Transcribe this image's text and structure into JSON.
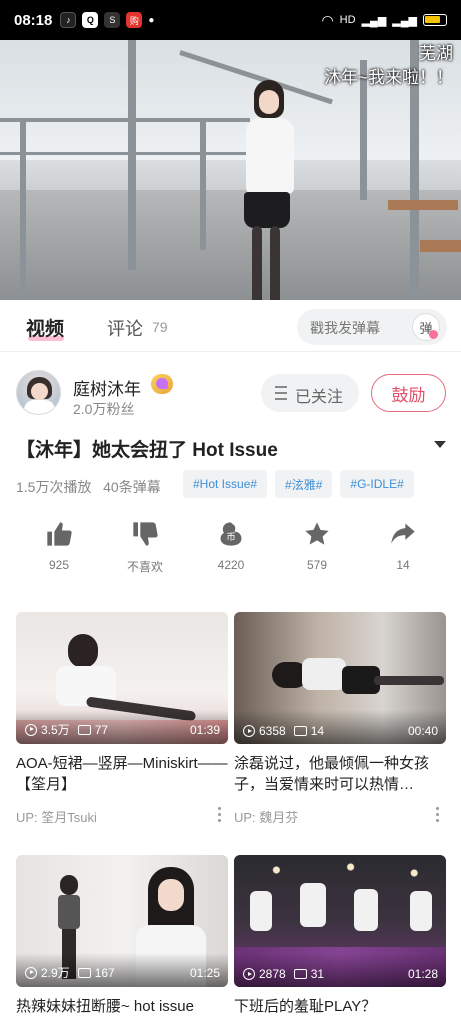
{
  "status_bar": {
    "time": "08:18",
    "network_label": "HD"
  },
  "video": {
    "overlay_line1": "芜湖",
    "overlay_line2": "沐年~我来啦！！"
  },
  "tabs": {
    "video_label": "视频",
    "comments_label": "评论",
    "comments_count": "79",
    "danmaku_placeholder": "戳我发弹幕",
    "danmaku_toggle_label": "弹"
  },
  "uploader": {
    "name": "庭树沐年",
    "fans": "2.0万粉丝",
    "follow_label": "已关注",
    "encourage_label": "鼓励"
  },
  "video_info": {
    "title": "【沐年】她太会扭了 Hot Issue",
    "plays": "1.5万次播放",
    "danmaku_count": "40条弹幕",
    "tags": [
      "#Hot Issue#",
      "#泫雅#",
      "#G-IDLE#"
    ]
  },
  "actions": [
    {
      "icon": "thumbs-up-icon",
      "label": "925"
    },
    {
      "icon": "thumbs-down-icon",
      "label": "不喜欢"
    },
    {
      "icon": "coin-icon",
      "label": "4220"
    },
    {
      "icon": "star-icon",
      "label": "579"
    },
    {
      "icon": "share-icon",
      "label": "14"
    }
  ],
  "recommendations": [
    {
      "plays": "3.5万",
      "danmaku": "77",
      "duration": "01:39",
      "title": "AOA-短裙—竖屏—Miniskirt——【筌月】",
      "up": "UP: 筌月Tsuki"
    },
    {
      "plays": "6358",
      "danmaku": "14",
      "duration": "00:40",
      "title": "涂磊说过，他最倾佩一种女孩子，当爱情来时可以热情…",
      "up": "UP: 魏月芬"
    },
    {
      "plays": "2.9万",
      "danmaku": "167",
      "duration": "01:25",
      "title": "热辣妹妹扭断腰~ hot issue",
      "up": ""
    },
    {
      "plays": "2878",
      "danmaku": "31",
      "duration": "01:28",
      "title": "下班后的羞耻PLAY？",
      "up": ""
    }
  ],
  "colors": {
    "accent_pink": "#fb7299",
    "tag_blue": "#3d8fd6"
  }
}
